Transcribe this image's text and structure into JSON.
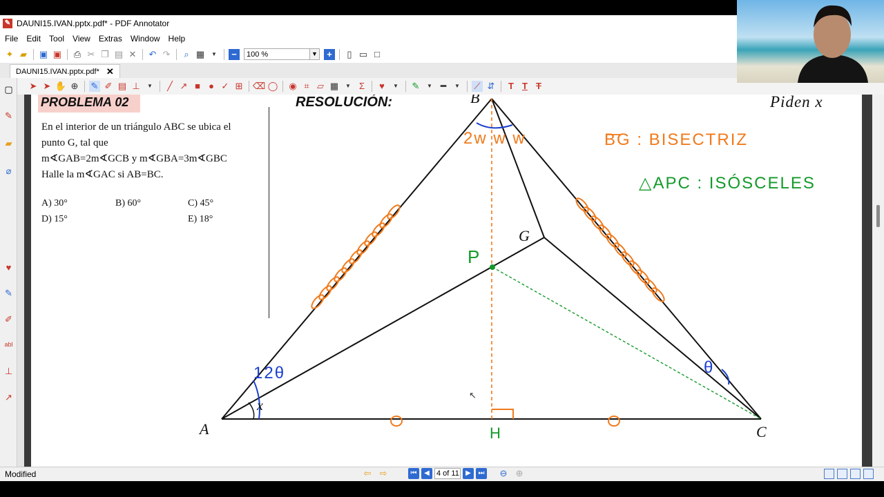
{
  "window": {
    "title": "DAUNI15.IVAN.pptx.pdf* - PDF Annotator"
  },
  "menu": [
    "File",
    "Edit",
    "Tool",
    "View",
    "Extras",
    "Window",
    "Help"
  ],
  "toolbar": {
    "zoom": "100 %"
  },
  "tab": {
    "label": "DAUNI15.IVAN.pptx.pdf*",
    "close": "✕"
  },
  "problem": {
    "header": "PROBLEMA 02",
    "lines": [
      "En el interior de un triángulo ABC se ubica el",
      "punto G, tal que",
      "m∢GAB=2m∢GCB y m∢GBA=3m∢GBC",
      "Halle la m∢GAC si AB=BC."
    ],
    "options": [
      "A) 30°",
      "B) 60°",
      "C) 45°",
      "D) 15°",
      "E) 18°"
    ]
  },
  "resolution": {
    "title": "RESOLUCIÓN:",
    "piden": "Piden x"
  },
  "figure": {
    "vertices": {
      "A": "A",
      "B": "B",
      "C": "C",
      "G": "G",
      "P": "P",
      "H": "H"
    },
    "angles": {
      "at_A_top": "12θ",
      "at_A_bottom": "x",
      "at_B": "2w w w",
      "at_C": "θ"
    },
    "notes": [
      "BG : BISECTRIZ",
      "△APC : ISÓSCELES"
    ],
    "colors": {
      "orange": "#f07a1c",
      "green": "#149a2a",
      "blue": "#1a3fd0",
      "black": "#111111"
    }
  },
  "status": {
    "text": "Modified",
    "page": "4 of 11"
  }
}
